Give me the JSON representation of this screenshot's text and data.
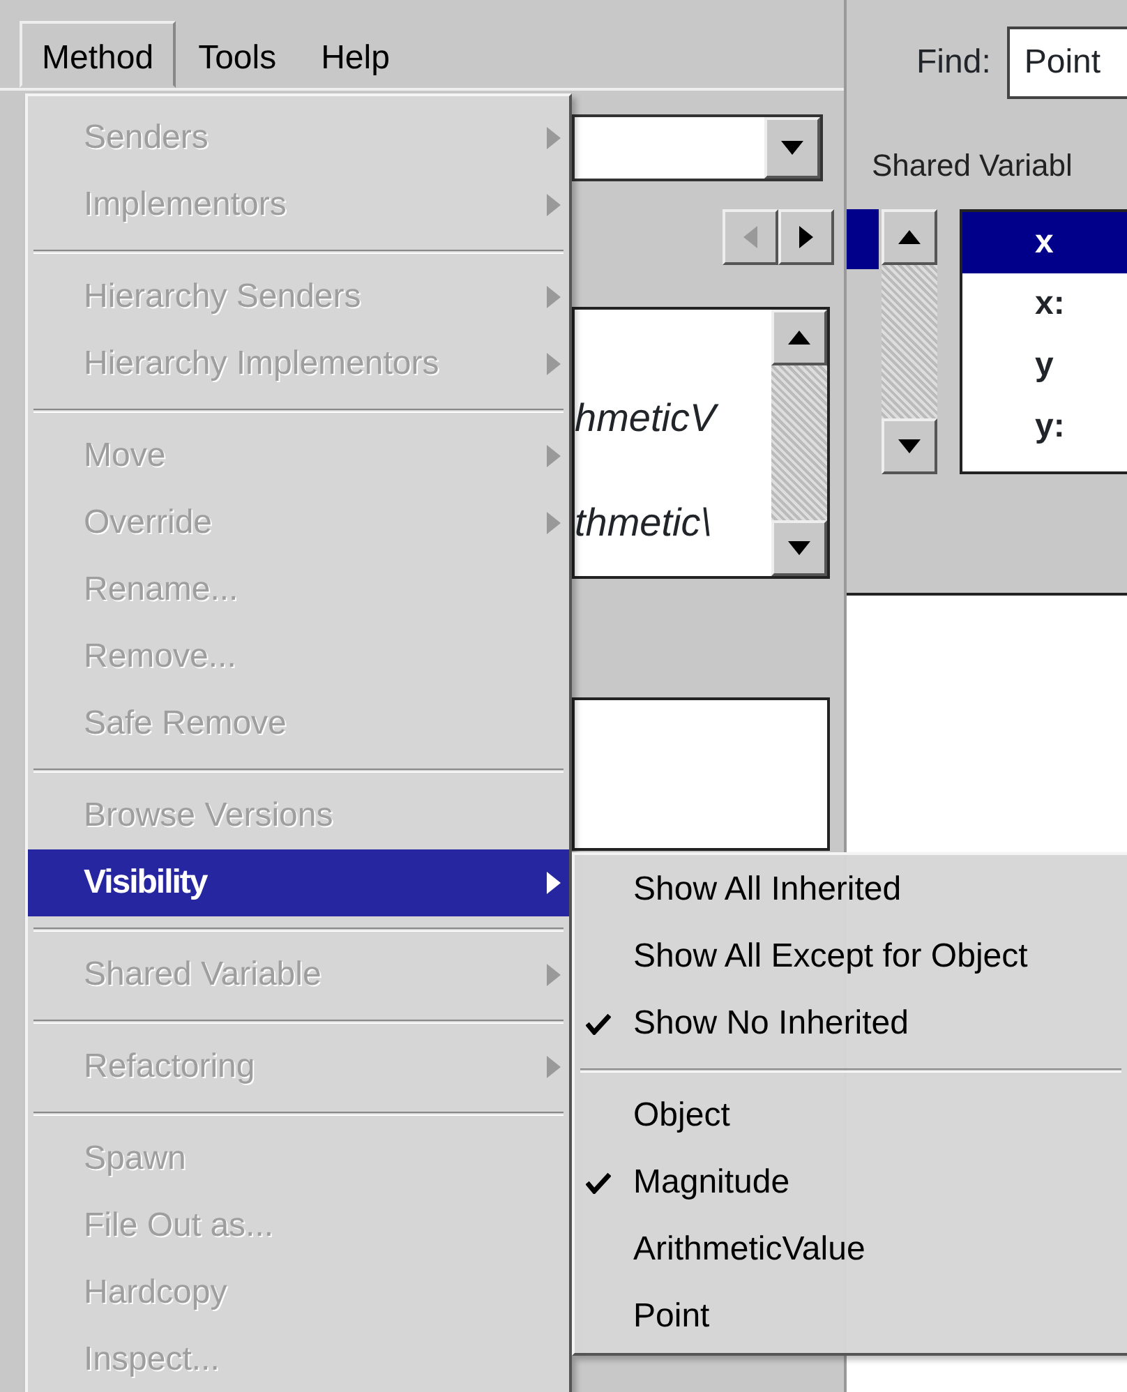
{
  "menubar": [
    {
      "label": "Method",
      "selected": true
    },
    {
      "label": "Tools",
      "selected": false
    },
    {
      "label": "Help",
      "selected": false
    }
  ],
  "background": {
    "find_label": "Find:",
    "find_value": "Point",
    "tab_label": "Shared Variabl",
    "method_list": [
      "hmeticV",
      "thmetic\\"
    ],
    "variables": [
      {
        "label": "x",
        "selected": true
      },
      {
        "label": "x:",
        "selected": false
      },
      {
        "label": "y",
        "selected": false
      },
      {
        "label": "y:",
        "selected": false
      }
    ]
  },
  "method_menu": [
    {
      "kind": "item",
      "label": "Senders",
      "disabled": true,
      "submenu": true,
      "selected": false
    },
    {
      "kind": "item",
      "label": "Implementors",
      "disabled": true,
      "submenu": true,
      "selected": false
    },
    {
      "kind": "separator"
    },
    {
      "kind": "item",
      "label": "Hierarchy Senders",
      "disabled": true,
      "submenu": true,
      "selected": false
    },
    {
      "kind": "item",
      "label": "Hierarchy Implementors",
      "disabled": true,
      "submenu": true,
      "selected": false
    },
    {
      "kind": "separator"
    },
    {
      "kind": "item",
      "label": "Move",
      "disabled": true,
      "submenu": true,
      "selected": false
    },
    {
      "kind": "item",
      "label": "Override",
      "disabled": true,
      "submenu": true,
      "selected": false
    },
    {
      "kind": "item",
      "label": "Rename...",
      "disabled": true,
      "submenu": false,
      "selected": false
    },
    {
      "kind": "item",
      "label": "Remove...",
      "disabled": true,
      "submenu": false,
      "selected": false
    },
    {
      "kind": "item",
      "label": "Safe Remove",
      "disabled": true,
      "submenu": false,
      "selected": false
    },
    {
      "kind": "separator"
    },
    {
      "kind": "item",
      "label": "Browse Versions",
      "disabled": true,
      "submenu": false,
      "selected": false
    },
    {
      "kind": "item",
      "label": "Visibility",
      "disabled": false,
      "submenu": true,
      "selected": true
    },
    {
      "kind": "separator"
    },
    {
      "kind": "item",
      "label": "Shared Variable",
      "disabled": true,
      "submenu": true,
      "selected": false
    },
    {
      "kind": "separator"
    },
    {
      "kind": "item",
      "label": "Refactoring",
      "disabled": true,
      "submenu": true,
      "selected": false
    },
    {
      "kind": "separator"
    },
    {
      "kind": "item",
      "label": "Spawn",
      "disabled": true,
      "submenu": false,
      "selected": false
    },
    {
      "kind": "item",
      "label": "File Out as...",
      "disabled": true,
      "submenu": false,
      "selected": false
    },
    {
      "kind": "item",
      "label": "Hardcopy",
      "disabled": true,
      "submenu": false,
      "selected": false
    },
    {
      "kind": "item",
      "label": "Inspect...",
      "disabled": true,
      "submenu": false,
      "selected": false
    }
  ],
  "visibility_submenu": [
    {
      "kind": "item",
      "label": "Show All Inherited",
      "checked": false
    },
    {
      "kind": "item",
      "label": "Show All Except for Object",
      "checked": false
    },
    {
      "kind": "item",
      "label": "Show No Inherited",
      "checked": true
    },
    {
      "kind": "separator"
    },
    {
      "kind": "item",
      "label": "Object",
      "checked": false
    },
    {
      "kind": "item",
      "label": "Magnitude",
      "checked": true
    },
    {
      "kind": "item",
      "label": "ArithmeticValue",
      "checked": false
    },
    {
      "kind": "item",
      "label": "Point",
      "checked": false
    }
  ]
}
